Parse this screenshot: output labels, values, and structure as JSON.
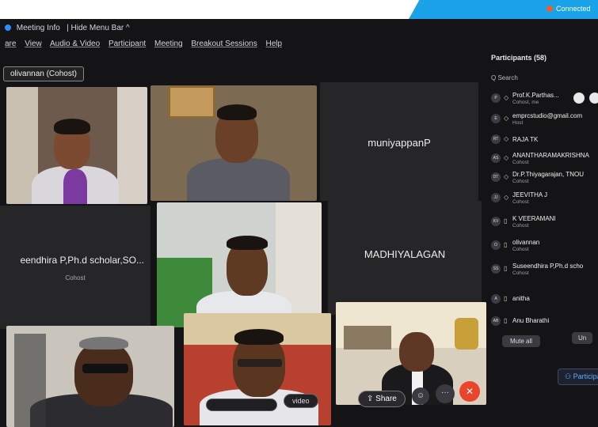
{
  "menu": {
    "meeting_info": "Meeting Info",
    "hide_menu_bar": "| Hide Menu Bar ^",
    "items": [
      "are",
      "View",
      "Audio & Video",
      "Participant",
      "Meeting",
      "Breakout Sessions",
      "Help"
    ],
    "host_chip": "olivannan (Cohost)"
  },
  "top_badge": "Connected",
  "tiles": {
    "muniyappan": "muniyappanP",
    "seendhira": "eendhira P,Ph.d scholar,SO...",
    "seendhira_role": "Cohost",
    "madhiyalagan": "MADHIYALAGAN"
  },
  "participants_panel": {
    "title": "Participants (58)",
    "search_placeholder": "Q Search",
    "rows": [
      {
        "initials": "P",
        "name": "Prof.K.Parthas...",
        "role": "Cohost, me"
      },
      {
        "initials": "E",
        "name": "emprcstudio@gmail.com",
        "role": "Host"
      },
      {
        "initials": "RT",
        "name": "RAJA TK",
        "role": ""
      },
      {
        "initials": "AS",
        "name": "ANANTHARAMAKRISHNA",
        "role": "Cohost"
      },
      {
        "initials": "DT",
        "name": "Dr.P.Thiyagarajan, TNOU",
        "role": "Cohost"
      },
      {
        "initials": "JJ",
        "name": "JEEVITHA J",
        "role": "Cohost"
      },
      {
        "initials": "KV",
        "name": "K VEERAMANI",
        "role": "Cohost"
      },
      {
        "initials": "O",
        "name": "olivannan",
        "role": "Cohost"
      },
      {
        "initials": "SS",
        "name": "Suseendhira P,Ph.d scho",
        "role": "Cohost"
      },
      {
        "initials": "A",
        "name": "anitha",
        "role": ""
      },
      {
        "initials": "AB",
        "name": "Anu Bharathi",
        "role": ""
      }
    ],
    "mute_all": "Mute all",
    "unmute_all": "Un"
  },
  "toolbar": {
    "video": "video",
    "share": "Share",
    "react": "☺",
    "more": "···",
    "leave": "✕",
    "participants": "Participants"
  },
  "colors": {
    "accent": "#1aa3e8",
    "leave": "#e8452c",
    "zoom_blue": "#2d8cff"
  }
}
